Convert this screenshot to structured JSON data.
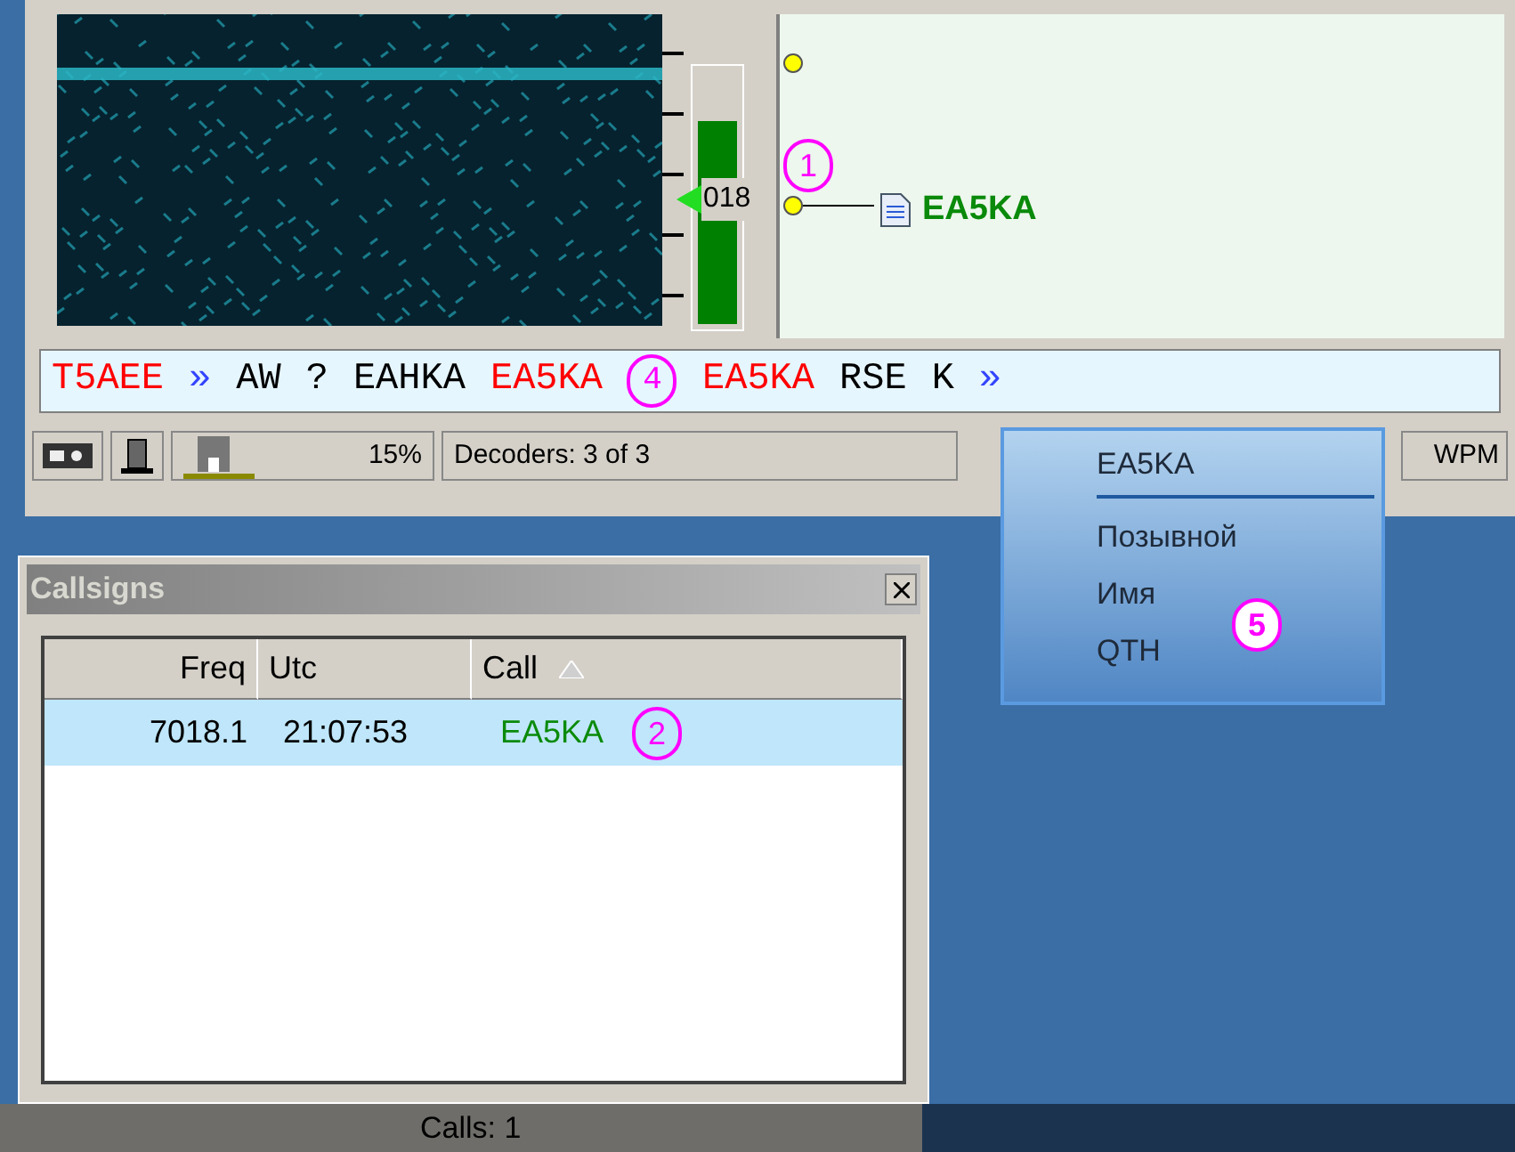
{
  "waterfall": {
    "scale_reading": "018",
    "level": 0.8
  },
  "station_map": {
    "callsign": "EA5KA",
    "annotation": "1"
  },
  "decoded_text": [
    {
      "text": "T5AEE",
      "kind": "call"
    },
    {
      "text": "»",
      "kind": "separator"
    },
    {
      "text": "AW",
      "kind": "plain"
    },
    {
      "text": "?",
      "kind": "plain"
    },
    {
      "text": "EAHKA",
      "kind": "plain"
    },
    {
      "text": "EA5KA",
      "kind": "call"
    },
    {
      "text": "4",
      "kind": "annotation"
    },
    {
      "text": "EA5KA",
      "kind": "call"
    },
    {
      "text": "RSE",
      "kind": "plain"
    },
    {
      "text": "K",
      "kind": "plain"
    },
    {
      "text": "»",
      "kind": "separator"
    }
  ],
  "status_bar": {
    "cpu": "15%",
    "decoders": "Decoders: 3 of 3",
    "speed": "WPM"
  },
  "callsigns_window": {
    "title": "Callsigns",
    "columns": [
      {
        "label": "Freq",
        "sorted": false
      },
      {
        "label": "Utc",
        "sorted": false
      },
      {
        "label": "Call",
        "sorted": true
      }
    ],
    "rows": [
      {
        "freq": "7018.1",
        "utc": "21:07:53",
        "call": "EA5KA",
        "selected": true,
        "annotation": "2"
      }
    ],
    "status": "Calls: 1"
  },
  "context_menu": {
    "header": "EA5KA",
    "items": [
      "Позывной",
      "Имя",
      "QTH"
    ],
    "annotation": "5"
  }
}
